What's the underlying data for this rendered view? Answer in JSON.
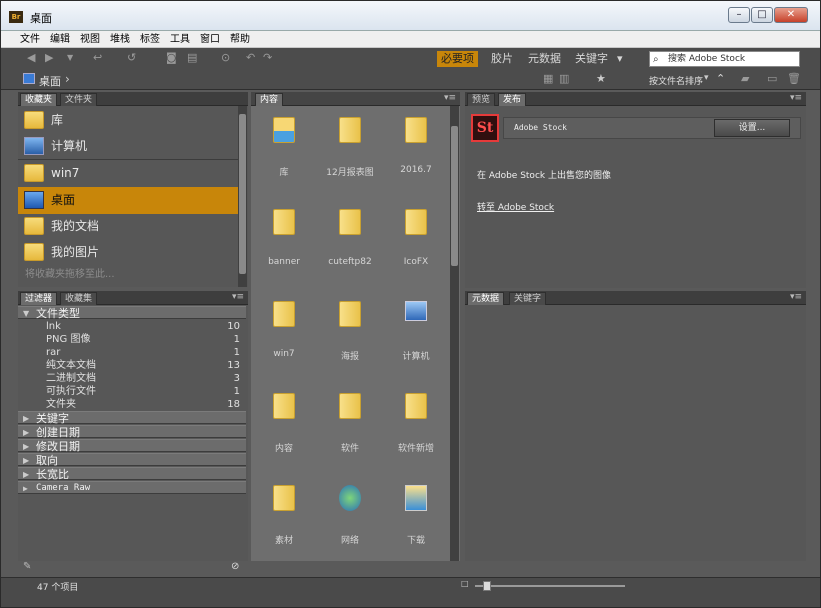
{
  "window": {
    "title": "桌面",
    "app_badge": "Br",
    "minimize": "–",
    "maximize": "□",
    "close": "✕"
  },
  "menu": [
    "文件",
    "编辑",
    "视图",
    "堆栈",
    "标签",
    "工具",
    "窗口",
    "帮助"
  ],
  "workspaces": {
    "essentials": "必要项",
    "filmstrip": "胶片",
    "metadata": "元数据",
    "keywords": "关键字",
    "more": "▾"
  },
  "search": {
    "placeholder": "搜索 Adobe Stock",
    "icon": "search-icon"
  },
  "breadcrumb": {
    "item": "桌面",
    "sep": "›"
  },
  "toolbar2": {
    "sort_label": "按文件名排序",
    "sort_arrow": "▾"
  },
  "favorites_panel": {
    "tabs": [
      "收藏夹",
      "文件夹"
    ],
    "items": [
      {
        "label": "库",
        "icon": "library-icon"
      },
      {
        "label": "计算机",
        "icon": "computer-icon"
      },
      {
        "label": "win7",
        "icon": "folder-icon"
      },
      {
        "label": "桌面",
        "icon": "desktop-icon",
        "selected": true
      },
      {
        "label": "我的文档",
        "icon": "documents-icon"
      },
      {
        "label": "我的图片",
        "icon": "pictures-icon"
      }
    ],
    "hint": "将收藏夹拖移至此..."
  },
  "filter_panel": {
    "tabs": [
      "过滤器",
      "收藏集"
    ],
    "file_type_header": "文件类型",
    "file_types": [
      {
        "label": "lnk",
        "count": "10"
      },
      {
        "label": "PNG 图像",
        "count": "1"
      },
      {
        "label": "rar",
        "count": "1"
      },
      {
        "label": "纯文本文档",
        "count": "13"
      },
      {
        "label": "二进制文档",
        "count": "3"
      },
      {
        "label": "可执行文件",
        "count": "1"
      },
      {
        "label": "文件夹",
        "count": "18"
      }
    ],
    "sections": [
      "关键字",
      "创建日期",
      "修改日期",
      "取向",
      "长宽比",
      "Camera Raw"
    ]
  },
  "content_panel": {
    "tab": "内容",
    "items": [
      {
        "label": "库",
        "icon": "library-icon"
      },
      {
        "label": "12月报表图",
        "icon": "folder-icon"
      },
      {
        "label": "2016.7",
        "icon": "folder-icon"
      },
      {
        "label": "banner",
        "icon": "folder-icon"
      },
      {
        "label": "cuteftp82",
        "icon": "folder-icon"
      },
      {
        "label": "IcoFX",
        "icon": "folder-icon"
      },
      {
        "label": "win7",
        "icon": "folder-icon"
      },
      {
        "label": "海报",
        "icon": "folder-icon"
      },
      {
        "label": "计算机",
        "icon": "computer-icon"
      },
      {
        "label": "内容",
        "icon": "folder-icon"
      },
      {
        "label": "软件",
        "icon": "folder-icon"
      },
      {
        "label": "软件新增",
        "icon": "folder-icon"
      },
      {
        "label": "素材",
        "icon": "folder-icon"
      },
      {
        "label": "网络",
        "icon": "network-icon"
      },
      {
        "label": "下载",
        "icon": "download-icon"
      }
    ]
  },
  "publish_panel": {
    "tabs": [
      "预览",
      "发布"
    ],
    "stock_logo": "St",
    "stock_name": "Adobe Stock",
    "settings_button": "设置...",
    "sell_text": "在 Adobe Stock 上出售您的图像",
    "goto_link": "转至 Adobe Stock"
  },
  "metadata_panel": {
    "tabs": [
      "元数据",
      "关键字"
    ]
  },
  "status": {
    "count": "47 个项目"
  },
  "colors": {
    "accent": "#c8860a",
    "panel": "#575757",
    "dark": "#3e3e3e"
  }
}
